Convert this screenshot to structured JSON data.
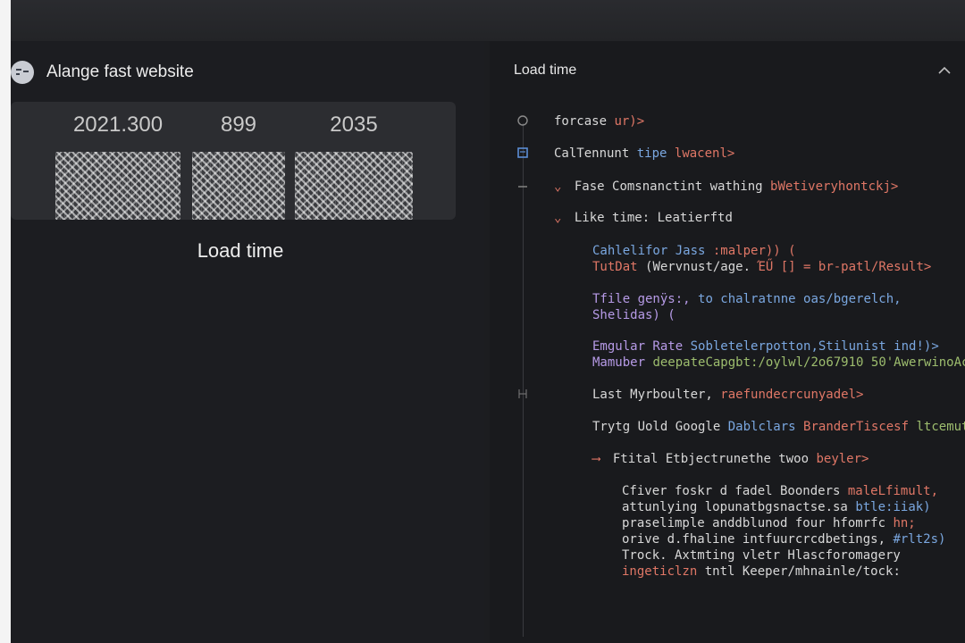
{
  "left": {
    "app_title": "Alange fast website",
    "stats": [
      "2021.300",
      "899",
      "2035"
    ],
    "caption": "Load time"
  },
  "right": {
    "header": "Load time",
    "lines": {
      "l1a": "forcase",
      "l1b": "ur)>",
      "l2a": "CalTennunt",
      "l2b": "tipe",
      "l2c": "lwacenl>",
      "l3a": "Fase Comsnanctint wathing",
      "l3b": "bWetiveryhontckj>",
      "l4a": "Like time: Leatierftd",
      "l5a": "Cahlelifor Jass",
      "l5b": ":malper)) (",
      "l6a": "TutDat",
      "l6b": "(Wervnust/age.",
      "l6c": "ΈŰ [] = br-patl/Result>",
      "l7a": "Tfile genÿs:,",
      "l7b": "to chalratnne oas/bgerelch,",
      "l8a": "Shelidas) (",
      "l9a": "Emgular Rate",
      "l9b": "Sobletelerpotton,Stilunist ind!)>",
      "l10a": "Mamuber",
      "l10b": "deepateCapgbt:/oylwl/2o67910 50'AwerwinoAc",
      "l11a": "Last Myrboulter,",
      "l11b": "raefundecrcunyadel>",
      "l12a": "Trytg Uold Google",
      "l12b": "Dablclars",
      "l12c": "BranderTiscesf",
      "l12d": "ltcemut.c",
      "l13a": "Ftital Etbjectrunethe twoo",
      "l13b": "beyler>",
      "p1": "Cfiver foskr d fadel Boonders",
      "p1b": "maleLfimult,",
      "p2": "attunlying lopunatbgsnactse.sa",
      "p2b": "btle:iiak)",
      "p3": "praselimple anddblunod four hfomrfc",
      "p3b": "hn;",
      "p4": "orive d.fhaline intfuurcrcdbetings,",
      "p4b": "#rlt2s)",
      "p5": "Trock. Axtmting vletr Hlascforomagery",
      "p6": "ingeticlzn",
      "p6b": "tntl Keeper/mhnainle/tock:"
    }
  },
  "colors": {
    "background": "#1c1d20",
    "card": "#2c2d31",
    "code_blue": "#7aa7e0",
    "code_red": "#e07766",
    "code_purple": "#b69ae6",
    "code_green": "#9dbd6e"
  },
  "icons": {
    "app": "menu-lines-icon",
    "collapse": "chevron-up-icon"
  }
}
